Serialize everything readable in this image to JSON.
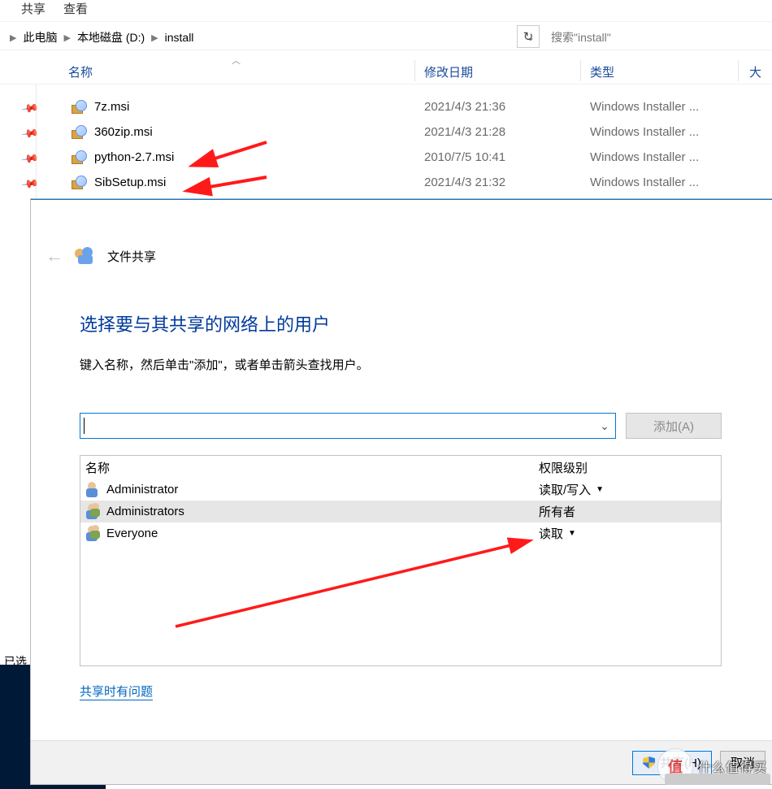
{
  "ribbon": {
    "tab_share": "共享",
    "tab_view": "查看"
  },
  "breadcrumb": {
    "seg1": "此电脑",
    "seg2": "本地磁盘 (D:)",
    "seg3": "install"
  },
  "search": {
    "placeholder": "搜索\"install\""
  },
  "columns": {
    "name": "名称",
    "date": "修改日期",
    "type": "类型",
    "size": "大"
  },
  "files": [
    {
      "name": "7z.msi",
      "date": "2021/4/3 21:36",
      "type": "Windows Installer ..."
    },
    {
      "name": "360zip.msi",
      "date": "2021/4/3 21:28",
      "type": "Windows Installer ..."
    },
    {
      "name": "python-2.7.msi",
      "date": "2010/7/5 10:41",
      "type": "Windows Installer ..."
    },
    {
      "name": "SibSetup.msi",
      "date": "2021/4/3 21:32",
      "type": "Windows Installer ..."
    }
  ],
  "status_bar": {
    "selected_prefix": "已选"
  },
  "dialog": {
    "window_title": "文件共享",
    "heading": "选择要与其共享的网络上的用户",
    "subtext": "键入名称，然后单击\"添加\"，或者单击箭头查找用户。",
    "add_button": "添加(A)",
    "col_name": "名称",
    "col_perm": "权限级别",
    "users": [
      {
        "name": "Administrator",
        "perm": "读取/写入",
        "has_arrow": true,
        "group": false,
        "selected": false
      },
      {
        "name": "Administrators",
        "perm": "所有者",
        "has_arrow": false,
        "group": true,
        "selected": true
      },
      {
        "name": "Everyone",
        "perm": "读取",
        "has_arrow": true,
        "group": true,
        "selected": false
      }
    ],
    "help_link": "共享时有问题",
    "share_button": "共享(H)",
    "cancel_button": "取消"
  },
  "watermark": {
    "symbol": "值",
    "text": "什么值得买"
  }
}
